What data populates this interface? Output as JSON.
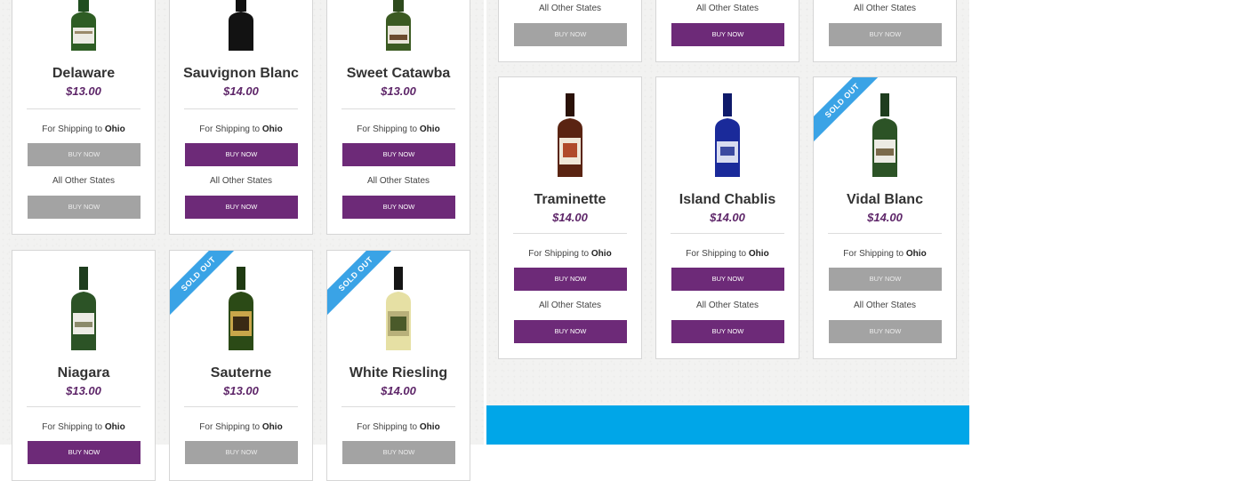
{
  "common": {
    "shipping_prefix": "For Shipping to ",
    "shipping_state": "Ohio",
    "other_states": "All Other States",
    "buy_now": "BUY NOW",
    "sold_out": "SOLD OUT"
  },
  "products": [
    {
      "name": "Delaware",
      "price": "$13.00",
      "ohio_available": false,
      "other_available": false,
      "sold_out": true
    },
    {
      "name": "Sauvignon Blanc",
      "price": "$14.00",
      "ohio_available": true,
      "other_available": true,
      "sold_out": false
    },
    {
      "name": "Sweet Catawba",
      "price": "$13.00",
      "ohio_available": true,
      "other_available": true,
      "sold_out": false
    },
    {
      "name": "Niagara",
      "price": "$13.00",
      "ohio_available": true,
      "sold_out": false
    },
    {
      "name": "Sauterne",
      "price": "$13.00",
      "ohio_available": false,
      "sold_out": true
    },
    {
      "name": "White Riesling",
      "price": "$14.00",
      "ohio_available": false,
      "sold_out": true
    },
    {
      "name": "Traminette",
      "price": "$14.00",
      "ohio_available": true,
      "other_available": true,
      "sold_out": false
    },
    {
      "name": "Island Chablis",
      "price": "$14.00",
      "ohio_available": true,
      "other_available": true,
      "sold_out": false
    },
    {
      "name": "Vidal Blanc",
      "price": "$14.00",
      "ohio_available": false,
      "other_available": false,
      "sold_out": true
    }
  ],
  "top_partial_cards": [
    {
      "other_available": false
    },
    {
      "other_available": true
    },
    {
      "other_available": false
    }
  ],
  "colors": {
    "buy_active": "#6d2a78",
    "buy_inactive": "#a3a3a3",
    "price": "#5e2669",
    "ribbon": "#3aa3e6",
    "footer": "#00a6e8"
  }
}
